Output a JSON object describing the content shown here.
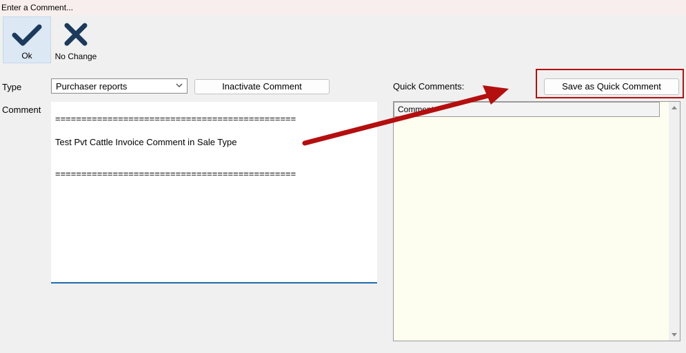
{
  "window": {
    "title": "Enter a Comment..."
  },
  "toolbar": {
    "ok_label": "Ok",
    "no_change_label": "No Change",
    "ok_icon": "checkmark-icon",
    "no_change_icon": "close-icon"
  },
  "form": {
    "type_label": "Type",
    "type_value": "Purchaser reports",
    "inactivate_label": "Inactivate Comment",
    "comment_label": "Comment",
    "comment_lines": [
      "==============================================",
      "Test Pvt Cattle Invoice Comment in Sale Type",
      "=============================================="
    ]
  },
  "quick": {
    "label": "Quick Comments:",
    "save_label": "Save as Quick Comment",
    "column_header": "Comment"
  },
  "colors": {
    "accent_blue": "#1e6bb0",
    "icon_navy": "#1b3a5c",
    "annotation_red": "#b50e0e",
    "list_background": "#fefef0"
  }
}
